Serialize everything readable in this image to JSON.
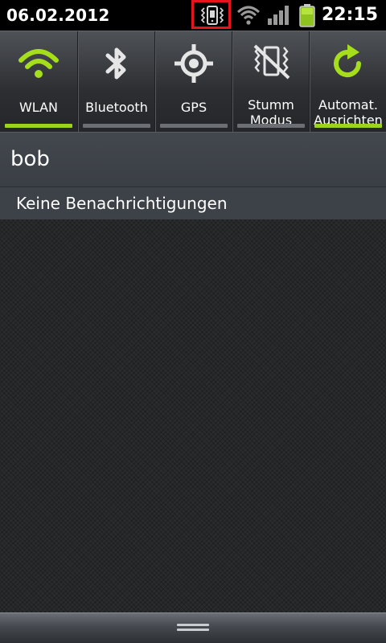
{
  "status_bar": {
    "date": "06.02.2012",
    "time": "22:15",
    "icons": [
      "vibrate-icon",
      "wifi-icon",
      "signal-icon",
      "battery-icon"
    ],
    "highlight_color": "#e8141d"
  },
  "quick_toggles": [
    {
      "label": "WLAN",
      "icon": "wifi-icon",
      "active": true
    },
    {
      "label": "Bluetooth",
      "icon": "bluetooth-icon",
      "active": false
    },
    {
      "label": "GPS",
      "icon": "gps-icon",
      "active": false
    },
    {
      "label": "Stumm Modus",
      "label_lines": [
        "Stumm",
        "Modus"
      ],
      "icon": "mute-icon",
      "active": false
    },
    {
      "label": "Automat. Ausrichten",
      "label_lines": [
        "Automat.",
        "Ausrichten"
      ],
      "icon": "auto-rotate-icon",
      "active": true
    }
  ],
  "owner": {
    "name": "bob"
  },
  "notifications": {
    "header": "Keine Benachrichtigungen",
    "items": []
  },
  "colors": {
    "accent_active": "#9bd51b",
    "inactive_bar": "#6b6e72",
    "panel_bg": "#3a3e45"
  }
}
